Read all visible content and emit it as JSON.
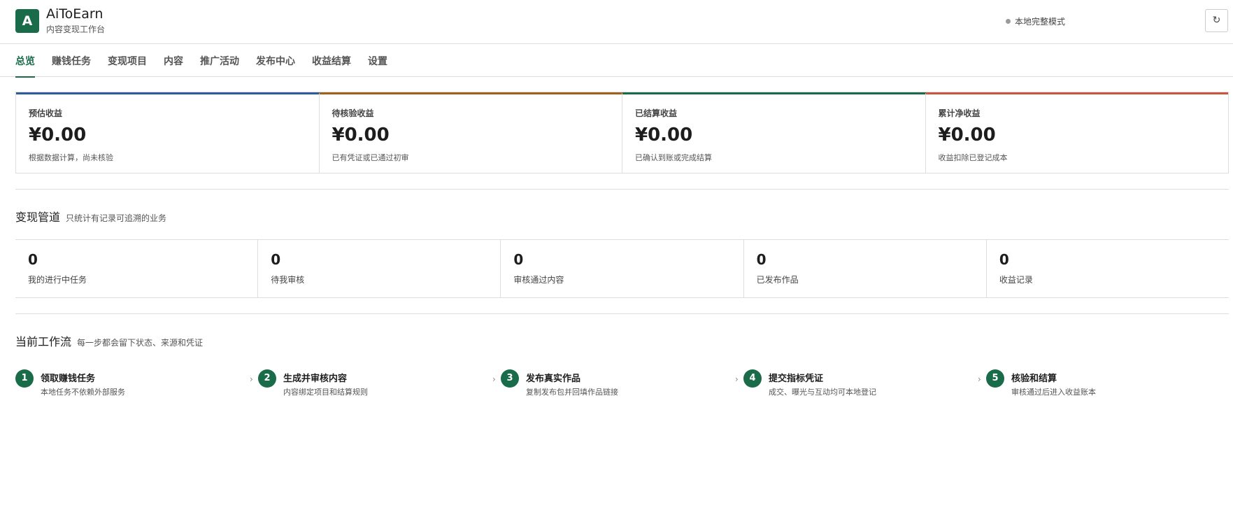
{
  "app": {
    "logo_letter": "A",
    "title": "AiToEarn",
    "subtitle": "内容变现工作台",
    "mode_label": "本地完整模式",
    "refresh_symbol": "↻"
  },
  "tabs": [
    {
      "label": "总览",
      "active": true
    },
    {
      "label": "赚钱任务",
      "active": false
    },
    {
      "label": "变现项目",
      "active": false
    },
    {
      "label": "内容",
      "active": false
    },
    {
      "label": "推广活动",
      "active": false
    },
    {
      "label": "发布中心",
      "active": false
    },
    {
      "label": "收益结算",
      "active": false
    },
    {
      "label": "设置",
      "active": false
    }
  ],
  "earnings": [
    {
      "label": "预估收益",
      "value": "¥0.00",
      "desc": "根据数据计算，尚未核验",
      "color": "#2d5d98"
    },
    {
      "label": "待核验收益",
      "value": "¥0.00",
      "desc": "已有凭证或已通过初审",
      "color": "#a0611e"
    },
    {
      "label": "已结算收益",
      "value": "¥0.00",
      "desc": "已确认到账或完成结算",
      "color": "#196b4a"
    },
    {
      "label": "累计净收益",
      "value": "¥0.00",
      "desc": "收益扣除已登记成本",
      "color": "#c8553d"
    }
  ],
  "pipeline": {
    "title": "变现管道",
    "note": "只统计有记录可追溯的业务",
    "items": [
      {
        "value": "0",
        "label": "我的进行中任务"
      },
      {
        "value": "0",
        "label": "待我审核"
      },
      {
        "value": "0",
        "label": "审核通过内容"
      },
      {
        "value": "0",
        "label": "已发布作品"
      },
      {
        "value": "0",
        "label": "收益记录"
      }
    ]
  },
  "workflow": {
    "title": "当前工作流",
    "note": "每一步都会留下状态、来源和凭证",
    "steps": [
      {
        "num": "1",
        "title": "领取赚钱任务",
        "desc": "本地任务不依赖外部服务"
      },
      {
        "num": "2",
        "title": "生成并审核内容",
        "desc": "内容绑定项目和结算规则"
      },
      {
        "num": "3",
        "title": "发布真实作品",
        "desc": "复制发布包并回填作品链接"
      },
      {
        "num": "4",
        "title": "提交指标凭证",
        "desc": "成交、曝光与互动均可本地登记"
      },
      {
        "num": "5",
        "title": "核验和结算",
        "desc": "审核通过后进入收益账本"
      }
    ]
  },
  "colors": {
    "brand": "#196b4a",
    "border": "#dddddd"
  }
}
